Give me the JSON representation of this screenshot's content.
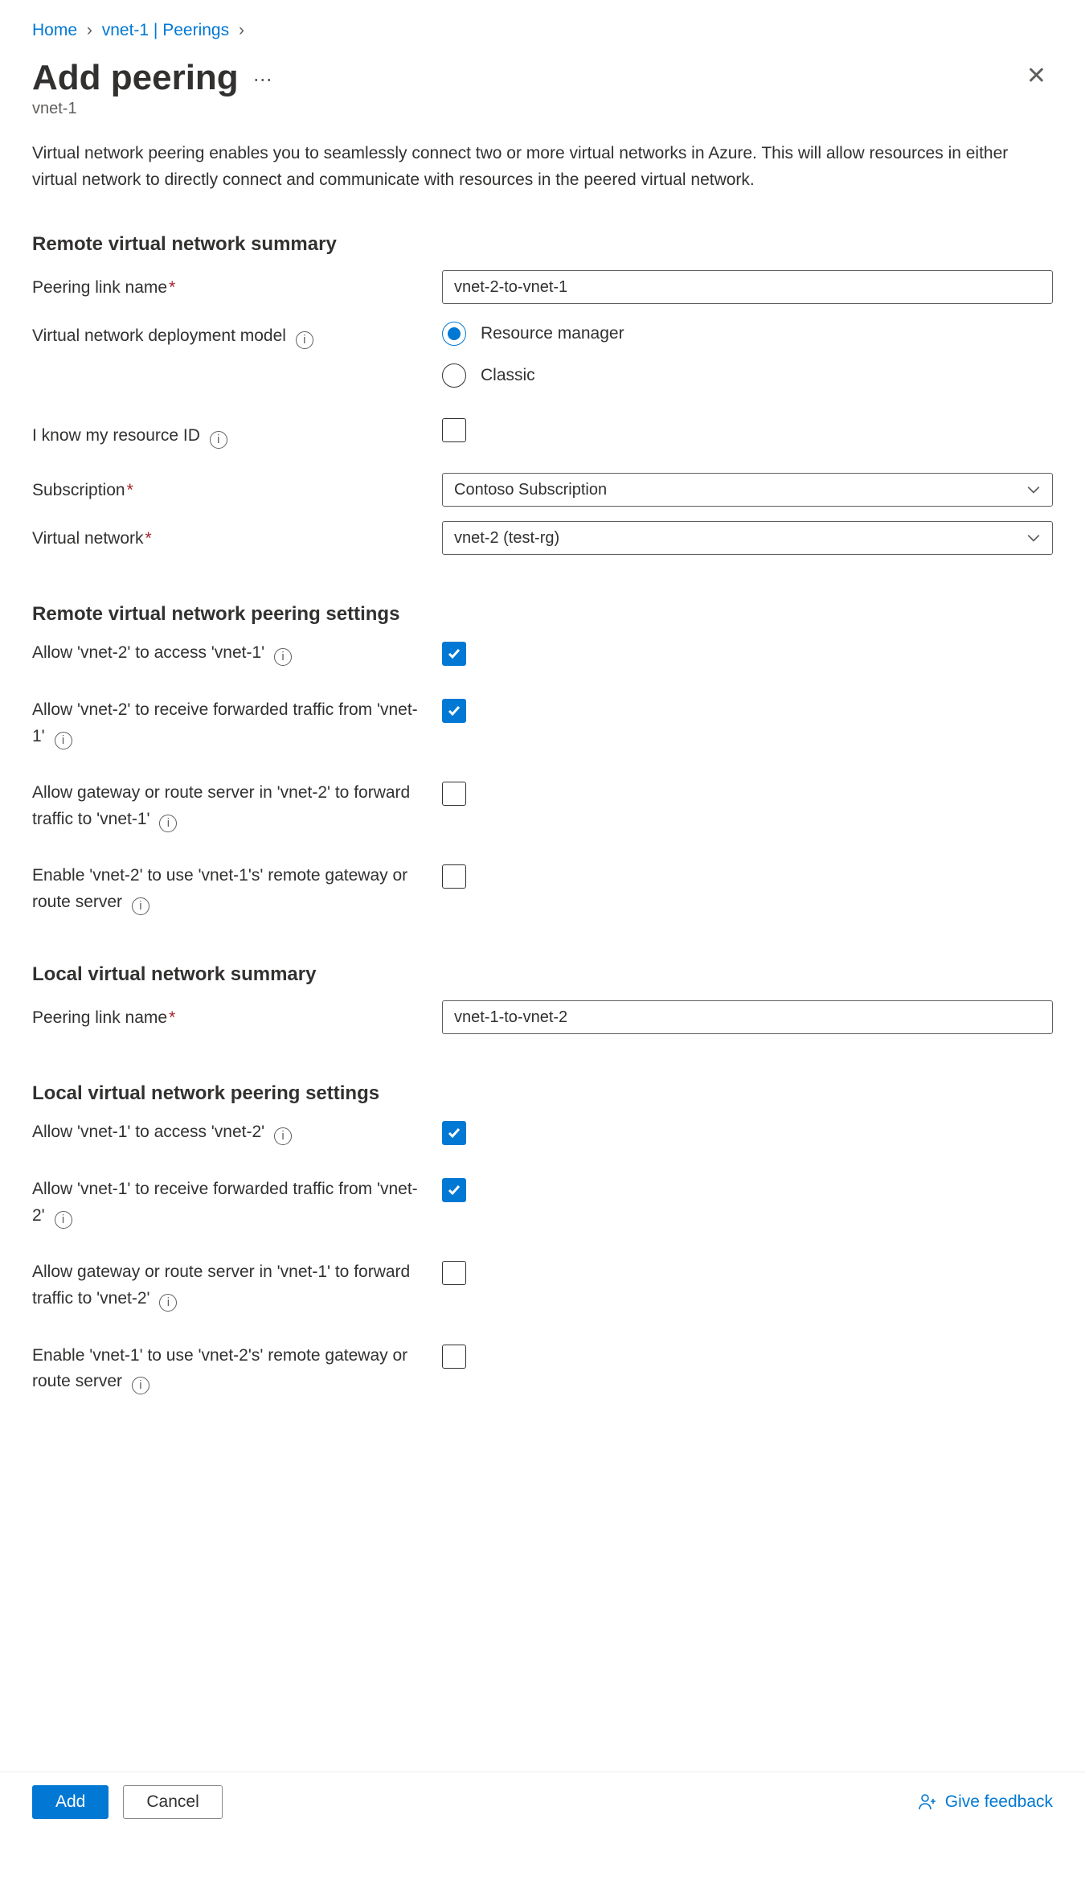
{
  "breadcrumb": {
    "home": "Home",
    "vnet": "vnet-1 | Peerings"
  },
  "header": {
    "title": "Add peering",
    "subtitle": "vnet-1"
  },
  "intro": "Virtual network peering enables you to seamlessly connect two or more virtual networks in Azure. This will allow resources in either virtual network to directly connect and communicate with resources in the peered virtual network.",
  "sections": {
    "remote_summary": "Remote virtual network summary",
    "remote_peering": "Remote virtual network peering settings",
    "local_summary": "Local virtual network summary",
    "local_peering": "Local virtual network peering settings"
  },
  "remote": {
    "link_label": "Peering link name",
    "link_value": "vnet-2-to-vnet-1",
    "deploy_model_label": "Virtual network deployment model",
    "deploy_model_opts": {
      "rm": "Resource manager",
      "classic": "Classic"
    },
    "know_resource_label": "I know my resource ID",
    "subscription_label": "Subscription",
    "subscription_value": "Contoso Subscription",
    "vnet_label": "Virtual network",
    "vnet_value": "vnet-2 (test-rg)"
  },
  "remote_peer": {
    "allow_access": "Allow 'vnet-2' to access 'vnet-1'",
    "allow_fwd": "Allow 'vnet-2' to receive forwarded traffic from 'vnet-1'",
    "allow_gateway": "Allow gateway or route server in 'vnet-2' to forward traffic to 'vnet-1'",
    "enable_remote_gw": "Enable 'vnet-2' to use 'vnet-1's' remote gateway or route server"
  },
  "local": {
    "link_label": "Peering link name",
    "link_value": "vnet-1-to-vnet-2"
  },
  "local_peer": {
    "allow_access": "Allow 'vnet-1' to access 'vnet-2'",
    "allow_fwd": "Allow 'vnet-1' to receive forwarded traffic from 'vnet-2'",
    "allow_gateway": "Allow gateway or route server in 'vnet-1' to forward traffic to 'vnet-2'",
    "enable_remote_gw": "Enable 'vnet-1' to use 'vnet-2's' remote gateway or route server"
  },
  "footer": {
    "add": "Add",
    "cancel": "Cancel",
    "feedback": "Give feedback"
  }
}
